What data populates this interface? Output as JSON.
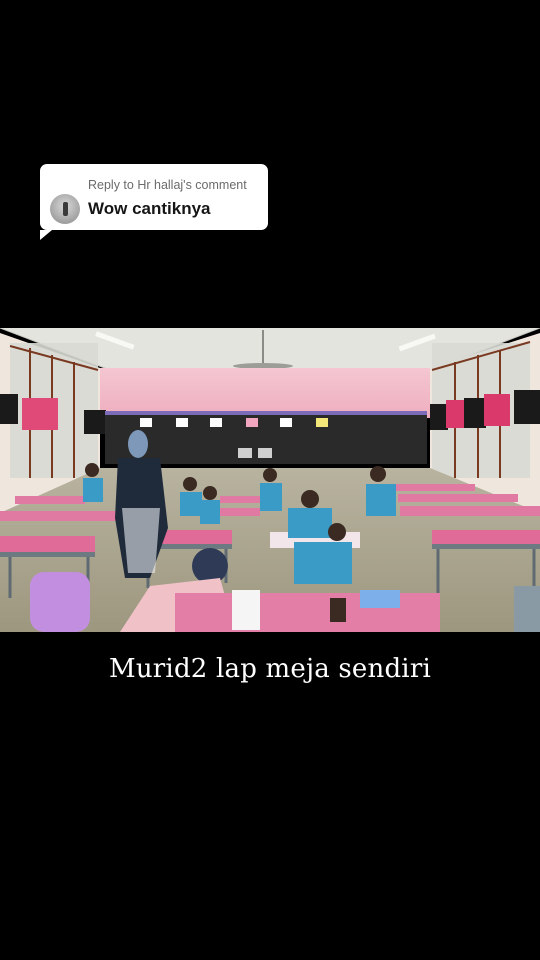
{
  "reply": {
    "header": "Reply to Hr hallaj's comment",
    "comment": "Wow cantiknya"
  },
  "caption": "Murid2 lap meja sendiri",
  "colors": {
    "background": "#000000",
    "card": "#ffffff",
    "wall_pink": "#f2b9c8",
    "desk_pink": "#e37fa6",
    "uniform_blue": "#3a9bc6"
  },
  "icons": {
    "avatar": "commenter-avatar-icon"
  }
}
